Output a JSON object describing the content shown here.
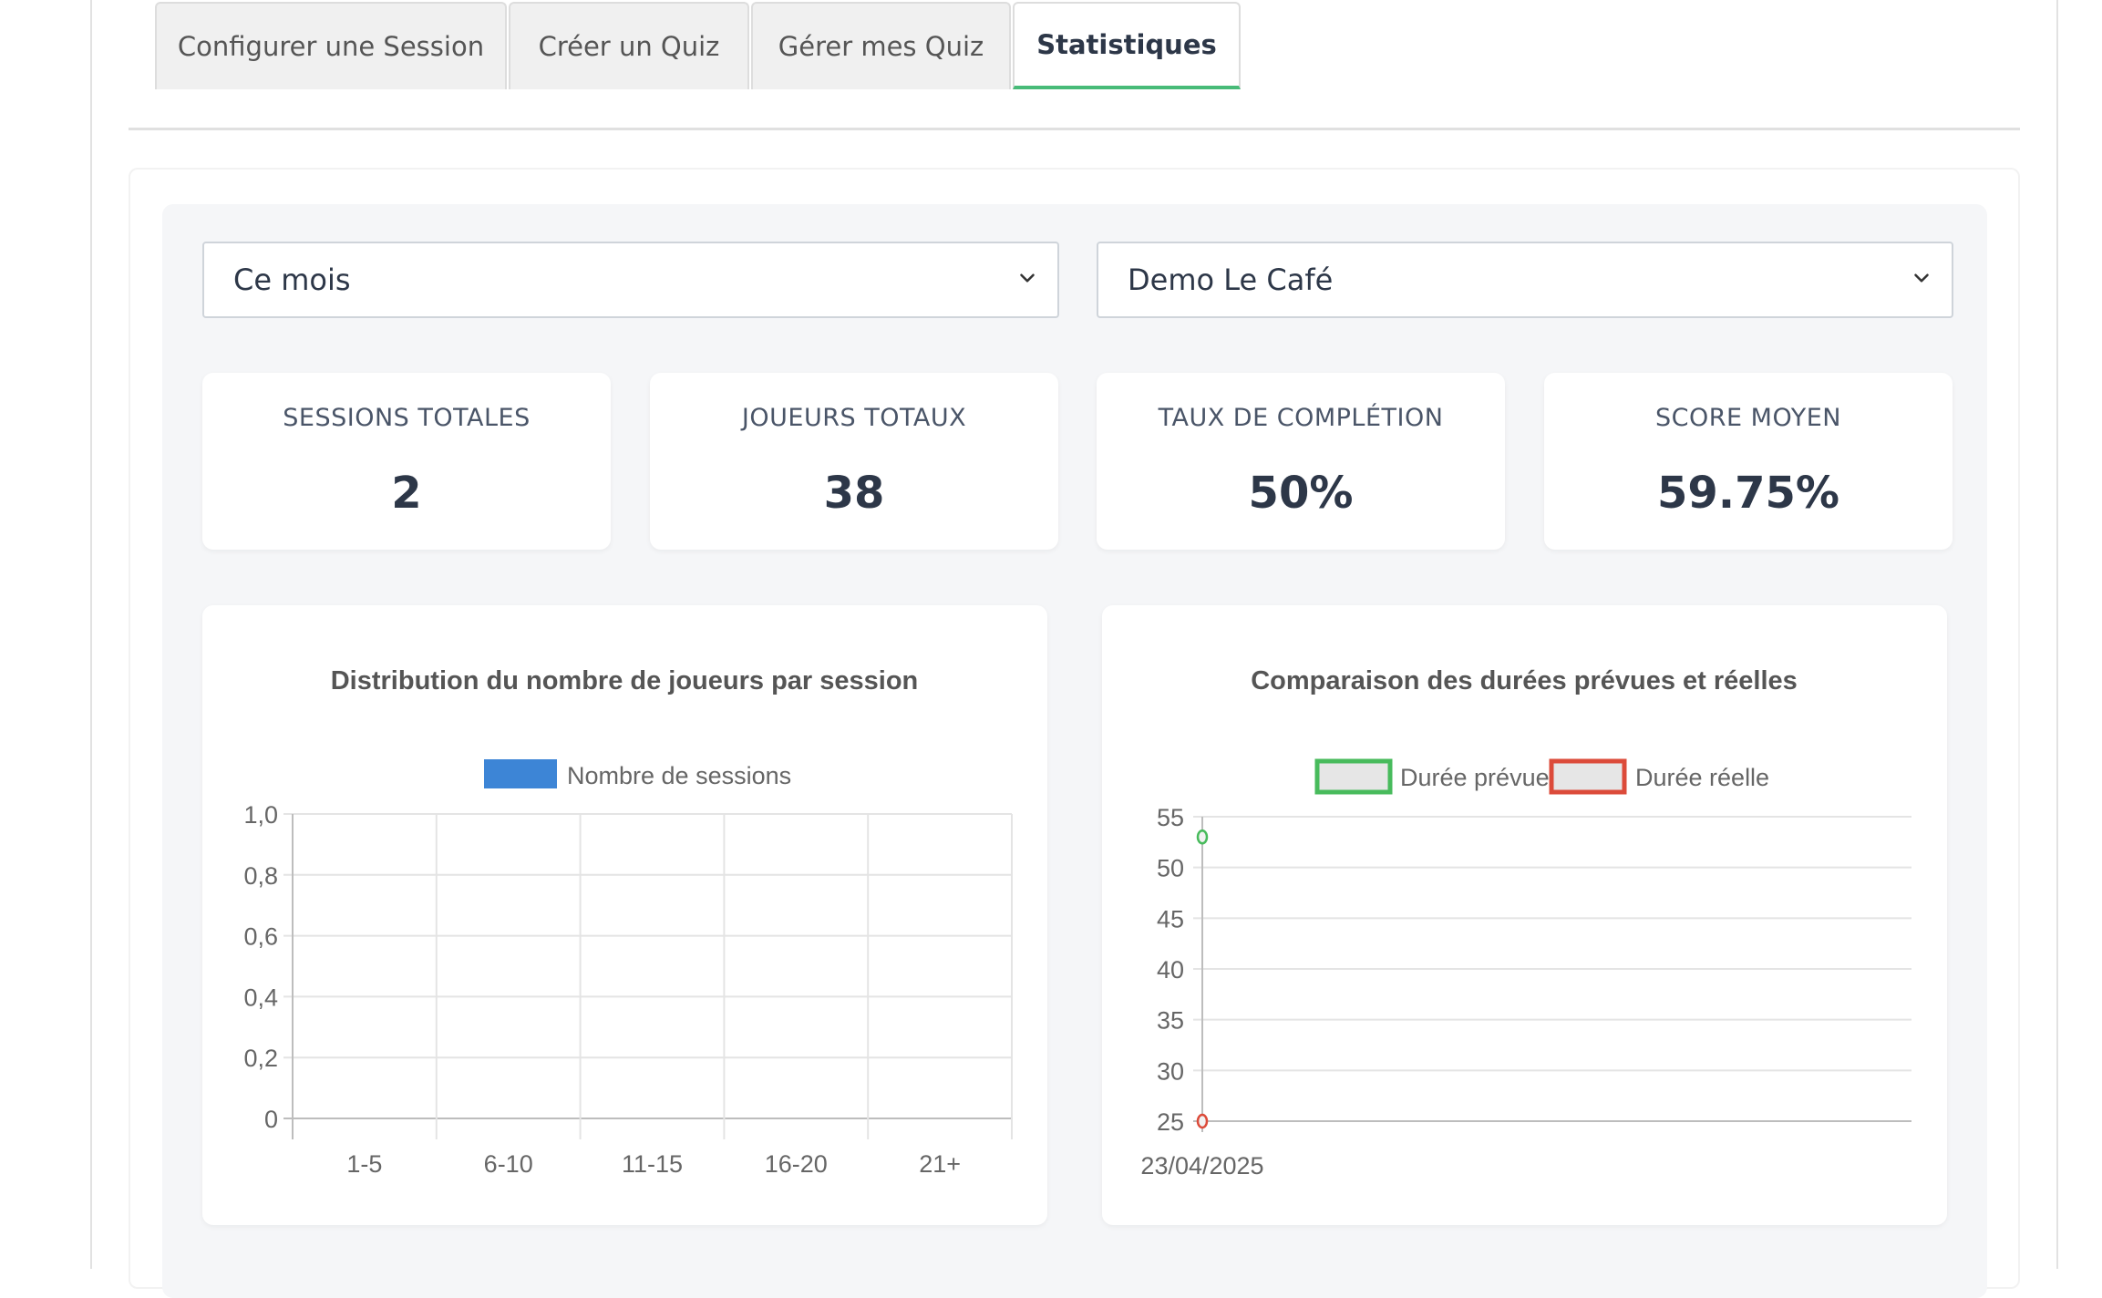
{
  "tabs": [
    {
      "label": "Configurer une Session",
      "active": false
    },
    {
      "label": "Créer un Quiz",
      "active": false
    },
    {
      "label": "Gérer mes Quiz",
      "active": false
    },
    {
      "label": "Statistiques",
      "active": true
    }
  ],
  "filters": {
    "period": "Ce mois",
    "venue": "Demo Le Café"
  },
  "stats": [
    {
      "label": "SESSIONS TOTALES",
      "value": "2"
    },
    {
      "label": "JOUEURS TOTAUX",
      "value": "38"
    },
    {
      "label": "TAUX DE COMPLÉTION",
      "value": "50%"
    },
    {
      "label": "SCORE MOYEN",
      "value": "59.75%"
    }
  ],
  "colors": {
    "accent": "#48bb78",
    "bar_series": "#3d85d6",
    "planned": "#48bb5c",
    "actual": "#dc4b3a"
  },
  "chart_data": [
    {
      "type": "bar",
      "title": "Distribution du nombre de joueurs par session",
      "categories": [
        "1-5",
        "6-10",
        "11-15",
        "16-20",
        "21+"
      ],
      "series": [
        {
          "name": "Nombre de sessions",
          "values": [
            0,
            0,
            0,
            0,
            0
          ]
        }
      ],
      "ylim": [
        0,
        1
      ],
      "yticks": [
        "0",
        "0,2",
        "0,4",
        "0,6",
        "0,8",
        "1,0"
      ],
      "grid": true,
      "legend": "top"
    },
    {
      "type": "line",
      "title": "Comparaison des durées prévues et réelles",
      "categories": [
        "23/04/2025"
      ],
      "series": [
        {
          "name": "Durée prévue",
          "values": [
            53
          ]
        },
        {
          "name": "Durée réelle",
          "values": [
            25
          ]
        }
      ],
      "ylim": [
        25,
        55
      ],
      "yticks": [
        "25",
        "30",
        "35",
        "40",
        "45",
        "50",
        "55"
      ],
      "grid": true,
      "legend": "top"
    }
  ]
}
